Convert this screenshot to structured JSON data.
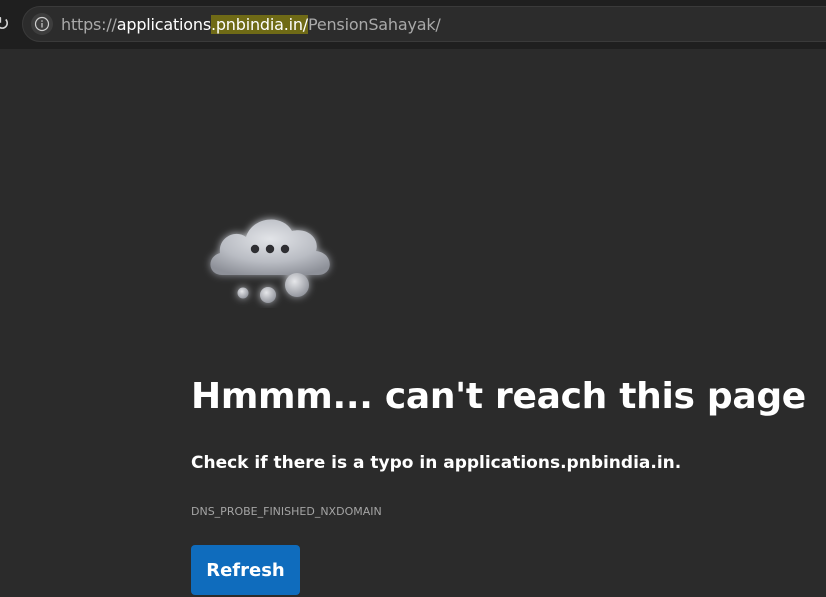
{
  "browser": {
    "url": {
      "scheme": "https://",
      "subdomain": "applications",
      "domain": ".pnbindia.in/",
      "path": "PensionSahayak/"
    }
  },
  "error_page": {
    "icon": "cloud-thinking-icon",
    "title": "Hmmm... can't reach this page",
    "message": "Check if there is a typo in applications.pnbindia.in.",
    "error_code": "DNS_PROBE_FINISHED_NXDOMAIN",
    "refresh_label": "Refresh"
  },
  "colors": {
    "background": "#2b2b2b",
    "toolbar": "#1f1f1f",
    "button": "#0f6cbd",
    "url_highlight": "#6f6a16"
  }
}
